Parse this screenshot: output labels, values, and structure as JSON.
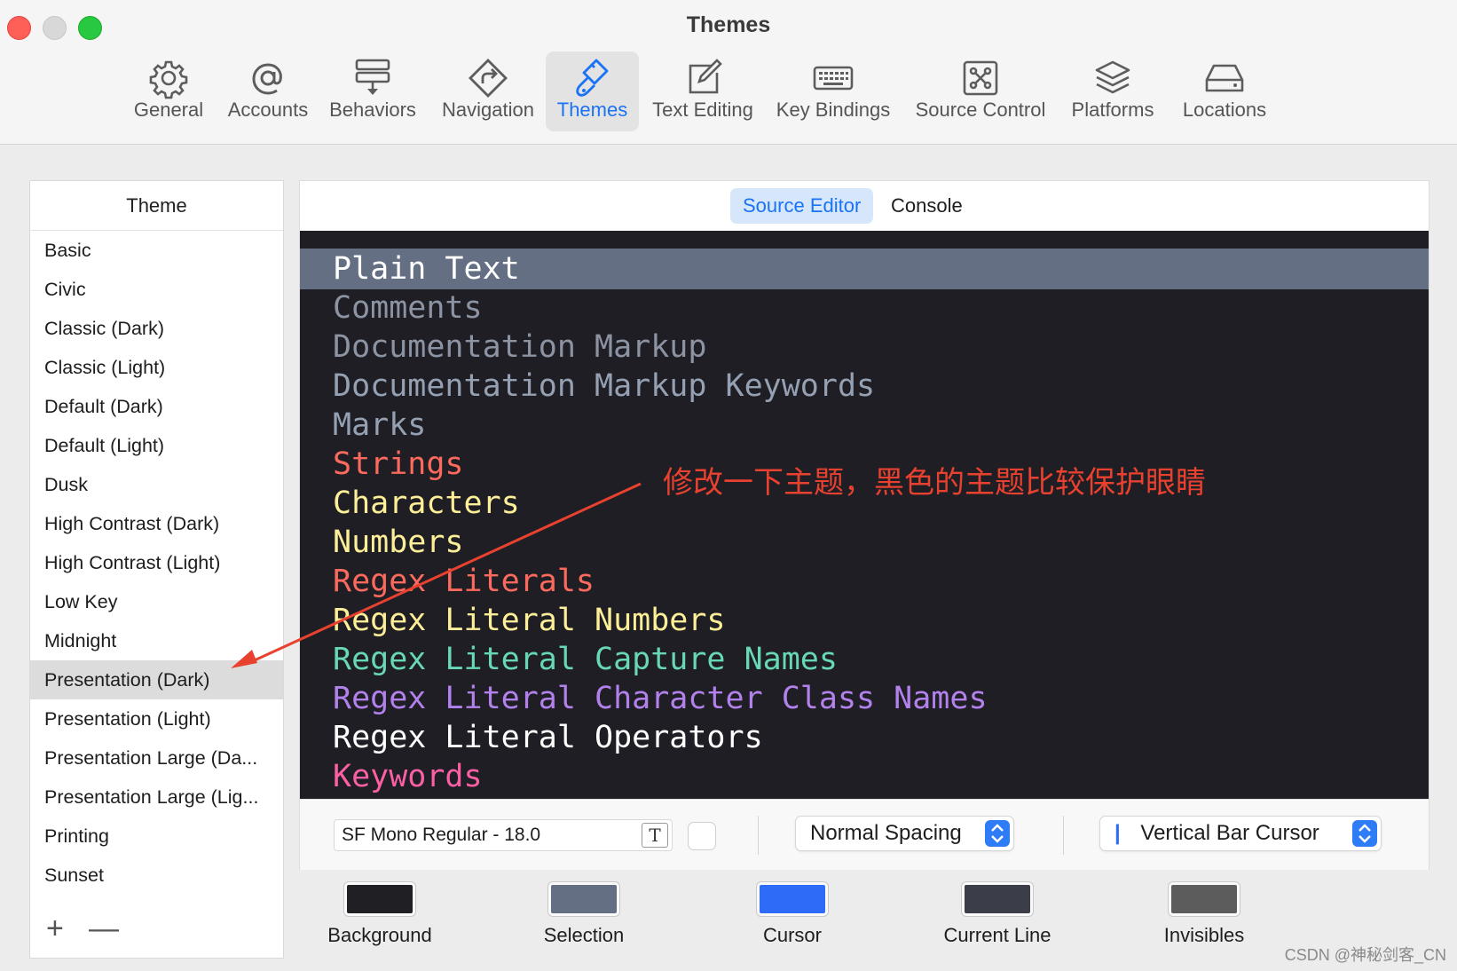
{
  "window": {
    "title": "Themes"
  },
  "toolbar": {
    "tabs": [
      {
        "label": "General",
        "icon": "gear-icon"
      },
      {
        "label": "Accounts",
        "icon": "at-sign-icon"
      },
      {
        "label": "Behaviors",
        "icon": "behaviors-icon"
      },
      {
        "label": "Navigation",
        "icon": "navigation-icon"
      },
      {
        "label": "Themes",
        "icon": "paintbrush-icon",
        "active": true
      },
      {
        "label": "Text Editing",
        "icon": "pencil-square-icon"
      },
      {
        "label": "Key Bindings",
        "icon": "keyboard-icon"
      },
      {
        "label": "Source Control",
        "icon": "source-control-icon"
      },
      {
        "label": "Platforms",
        "icon": "layers-icon"
      },
      {
        "label": "Locations",
        "icon": "drive-icon"
      }
    ]
  },
  "theme_list": {
    "header": "Theme",
    "items": [
      "Basic",
      "Civic",
      "Classic (Dark)",
      "Classic (Light)",
      "Default (Dark)",
      "Default (Light)",
      "Dusk",
      "High Contrast (Dark)",
      "High Contrast (Light)",
      "Low Key",
      "Midnight",
      "Presentation (Dark)",
      "Presentation (Light)",
      "Presentation Large (Da...",
      "Presentation Large (Lig...",
      "Printing",
      "Sunset"
    ],
    "selected": "Presentation (Dark)",
    "add_symbol": "+",
    "remove_symbol": "—"
  },
  "editor": {
    "segments": {
      "source_editor": "Source Editor",
      "console": "Console"
    },
    "preview_lines": [
      {
        "text": "Plain Text",
        "color": "#ffffff"
      },
      {
        "text": "Comments",
        "color": "#8c93a2"
      },
      {
        "text": "Documentation Markup",
        "color": "#8c93a2"
      },
      {
        "text": "Documentation Markup Keywords",
        "color": "#95a0b2"
      },
      {
        "text": "Marks",
        "color": "#95a0b2"
      },
      {
        "text": "Strings",
        "color": "#fc6a5d"
      },
      {
        "text": "Characters",
        "color": "#fdee98"
      },
      {
        "text": "Numbers",
        "color": "#fdee98"
      },
      {
        "text": "Regex Literals",
        "color": "#fc6a5d"
      },
      {
        "text": "Regex Literal Numbers",
        "color": "#fdee98"
      },
      {
        "text": "Regex Literal Capture Names",
        "color": "#67d7b5"
      },
      {
        "text": "Regex Literal Character Class Names",
        "color": "#b281eb"
      },
      {
        "text": "Regex Literal Operators",
        "color": "#ffffff"
      },
      {
        "text": "Keywords",
        "color": "#fc5fa3"
      }
    ],
    "selected_line_bg": "#646f83",
    "font": "SF Mono Regular - 18.0",
    "font_button_glyph": "T",
    "spacing": "Normal Spacing",
    "cursor": "Vertical Bar Cursor",
    "cursor_glyph": "|"
  },
  "swatches": [
    {
      "label": "Background",
      "color": "#1f1f24"
    },
    {
      "label": "Selection",
      "color": "#646f83"
    },
    {
      "label": "Cursor",
      "color": "#2e6bf6"
    },
    {
      "label": "Current Line",
      "color": "#3b3d49"
    },
    {
      "label": "Invisibles",
      "color": "#5c5c5c"
    }
  ],
  "annotation": {
    "text": "修改一下主题，黑色的主题比较保护眼睛",
    "color": "#e8412f"
  },
  "watermark": "CSDN @神秘剑客_CN"
}
